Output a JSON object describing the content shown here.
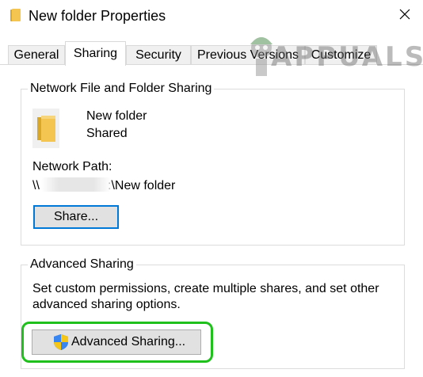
{
  "window": {
    "title": "New folder Properties",
    "title_icon": "folder-icon",
    "close_icon": "close-icon"
  },
  "tabs": [
    {
      "label": "General",
      "active": false
    },
    {
      "label": "Sharing",
      "active": true
    },
    {
      "label": "Security",
      "active": false
    },
    {
      "label": "Previous Versions",
      "active": false
    },
    {
      "label": "Customize",
      "active": false
    }
  ],
  "network_sharing": {
    "group_title": "Network File and Folder Sharing",
    "folder_icon": "folder-icon",
    "folder_name": "New folder",
    "folder_status": "Shared",
    "path_label": "Network Path:",
    "path_prefix": "\\\\",
    "path_suffix": ":\\New folder",
    "share_button": "Share..."
  },
  "advanced_sharing": {
    "group_title": "Advanced Sharing",
    "description_line1": "Set custom permissions, create multiple shares, and set other",
    "description_line2": "advanced sharing options.",
    "button_label": "Advanced Sharing...",
    "button_icon": "uac-shield-icon"
  },
  "watermark": {
    "text": "APPUALS"
  },
  "colors": {
    "highlight": "#1fc01c",
    "focus_border": "#0078d7",
    "folder": "#f4c551"
  }
}
